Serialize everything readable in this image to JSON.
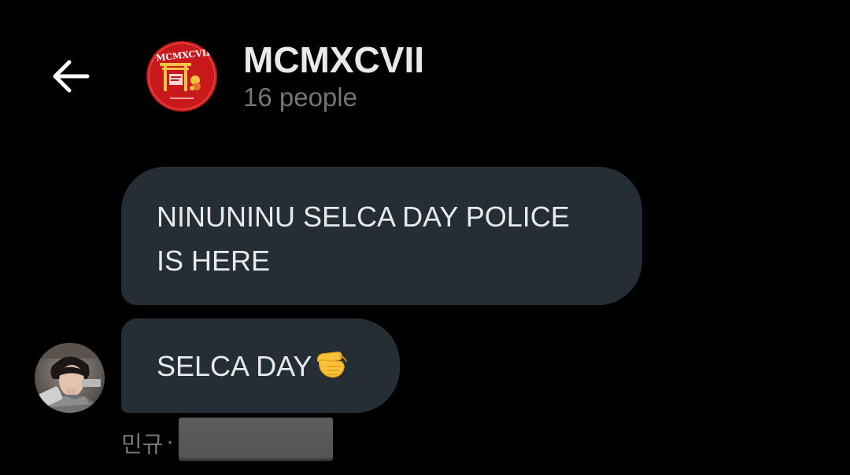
{
  "header": {
    "back_icon": "arrow-left-icon",
    "title": "MCMXCVII",
    "subtitle": "16 people",
    "avatar_text": "MCMXCVII",
    "avatar_colors": {
      "background": "#c8181c",
      "accent": "#f4c542"
    }
  },
  "messages": [
    {
      "text_line1": "NINUNINU SELCA DAY POLICE",
      "text_line2": "IS HERE"
    },
    {
      "text": "SELCA DAY",
      "emoji_icon": "pointing-finger-emoji-icon"
    }
  ],
  "meta": {
    "sender": "민규",
    "separator": "·"
  },
  "colors": {
    "background": "#000000",
    "bubble": "#252d35",
    "text": "#e7e9ea",
    "secondary_text": "#71767b"
  }
}
